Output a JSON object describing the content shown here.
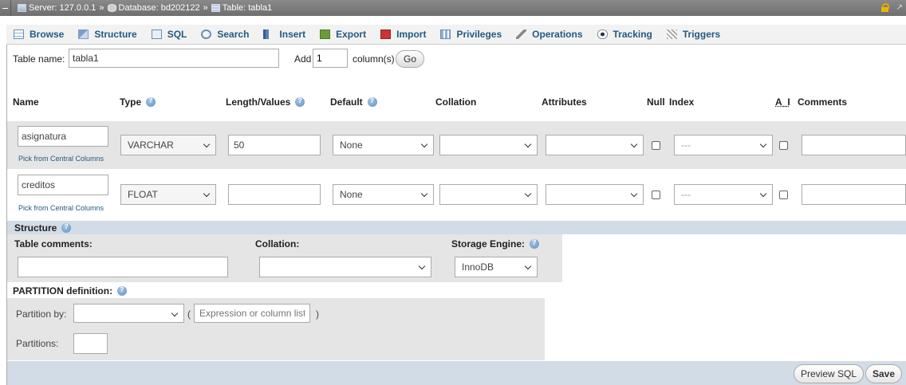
{
  "breadcrumb": {
    "server_label": "Server: 127.0.0.1",
    "sep": "»",
    "database_label": "Database: bd202122",
    "table_label": "Table: tabla1"
  },
  "tabs": [
    {
      "label": "Browse",
      "icon": "browse-icon"
    },
    {
      "label": "Structure",
      "icon": "structure-icon"
    },
    {
      "label": "SQL",
      "icon": "sql-icon"
    },
    {
      "label": "Search",
      "icon": "search-icon"
    },
    {
      "label": "Insert",
      "icon": "insert-icon"
    },
    {
      "label": "Export",
      "icon": "export-icon"
    },
    {
      "label": "Import",
      "icon": "import-icon"
    },
    {
      "label": "Privileges",
      "icon": "privileges-icon"
    },
    {
      "label": "Operations",
      "icon": "operations-icon"
    },
    {
      "label": "Tracking",
      "icon": "tracking-icon"
    },
    {
      "label": "Triggers",
      "icon": "triggers-icon"
    }
  ],
  "table_form": {
    "table_name_label": "Table name:",
    "table_name_value": "tabla1",
    "add_label": "Add",
    "add_value": "1",
    "columns_label": "column(s)",
    "go_label": "Go"
  },
  "headers": {
    "name": "Name",
    "type": "Type",
    "length": "Length/Values",
    "default": "Default",
    "collation": "Collation",
    "attributes": "Attributes",
    "null": "Null",
    "index": "Index",
    "ai": "A_I",
    "comments": "Comments"
  },
  "columns": [
    {
      "name": "asignatura",
      "pick_label": "Pick from Central Columns",
      "type": "VARCHAR",
      "length": "50",
      "default": "None",
      "collation": "",
      "attributes": "",
      "index": "---",
      "comments": ""
    },
    {
      "name": "creditos",
      "pick_label": "Pick from Central Columns",
      "type": "FLOAT",
      "length": "",
      "default": "None",
      "collation": "",
      "attributes": "",
      "index": "---",
      "comments": ""
    }
  ],
  "structure": {
    "title": "Structure",
    "table_comments_label": "Table comments:",
    "table_comments_value": "",
    "collation_label": "Collation:",
    "collation_value": "",
    "storage_engine_label": "Storage Engine:",
    "storage_engine_value": "InnoDB"
  },
  "partition": {
    "title": "PARTITION definition:",
    "partition_by_label": "Partition by:",
    "partition_by_value": "",
    "paren_open": "(",
    "paren_close": ")",
    "expression_placeholder": "Expression or column list",
    "partitions_label": "Partitions:",
    "partitions_value": ""
  },
  "actions": {
    "preview_sql_label": "Preview SQL",
    "save_label": "Save"
  }
}
